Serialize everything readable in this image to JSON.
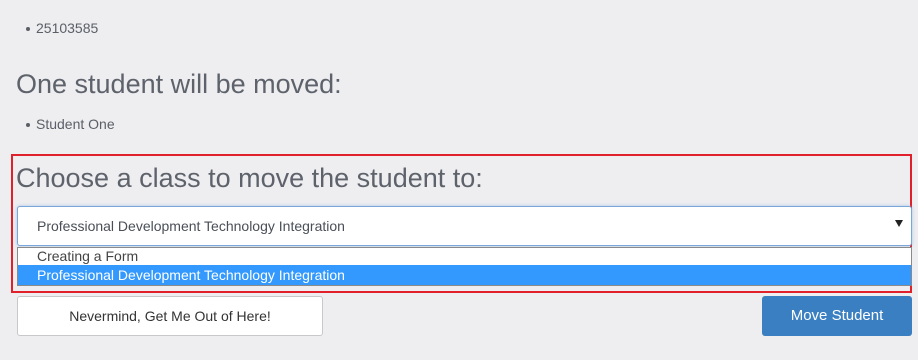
{
  "student_ids": [
    "25103585"
  ],
  "moved_heading": "One student will be moved:",
  "students": [
    "Student One"
  ],
  "choose_heading": "Choose a class to move the student to:",
  "class_select": {
    "selected_value": "Professional Development Technology Integration",
    "options": [
      "Creating a Form",
      "Professional Development Technology Integration"
    ]
  },
  "buttons": {
    "cancel_label": "Nevermind, Get Me Out of Here!",
    "submit_label": "Move Student"
  },
  "colors": {
    "highlight": "#e0202a",
    "primary": "#3a7fc1",
    "option_selected": "#3399ff"
  }
}
